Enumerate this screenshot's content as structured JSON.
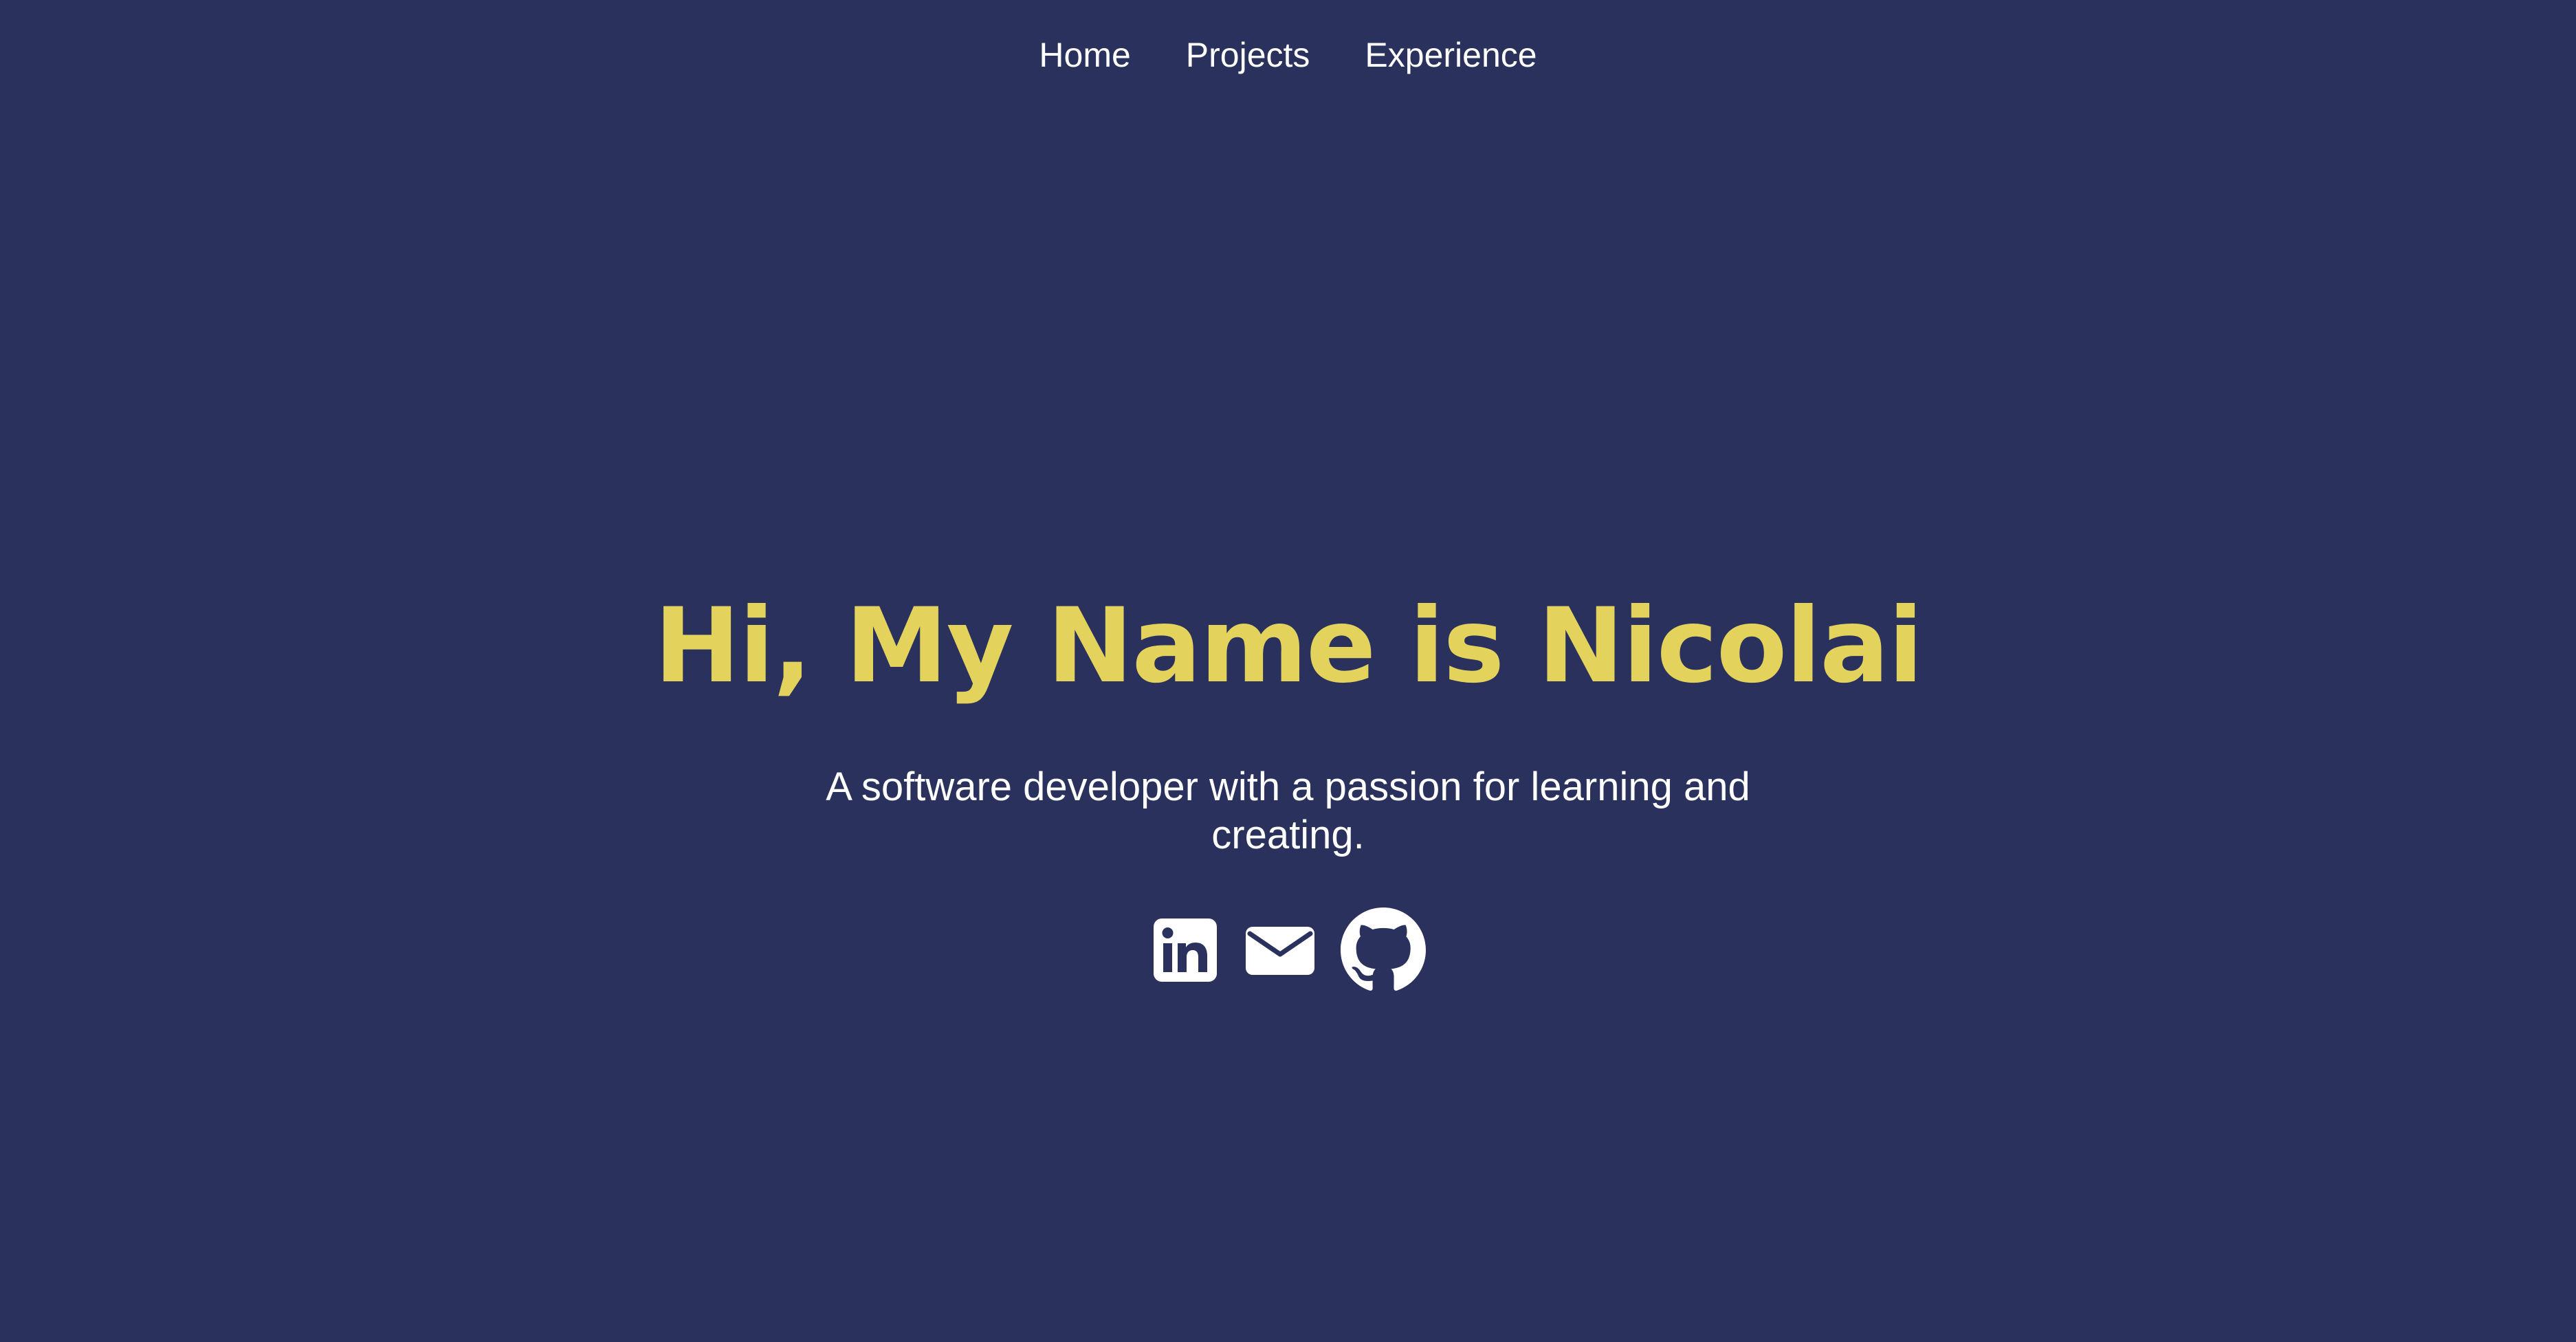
{
  "nav": {
    "items": [
      {
        "label": "Home"
      },
      {
        "label": "Projects"
      },
      {
        "label": "Experience"
      }
    ]
  },
  "hero": {
    "title": "Hi, My Name is Nicolai",
    "subtitle": "A software developer with a passion for learning and creating."
  },
  "socials": {
    "items": [
      {
        "icon": "linkedin-icon"
      },
      {
        "icon": "mail-icon"
      },
      {
        "icon": "github-icon"
      }
    ]
  },
  "colors": {
    "background": "#29315c",
    "accent": "#e3d35c",
    "text": "#ffffff"
  }
}
